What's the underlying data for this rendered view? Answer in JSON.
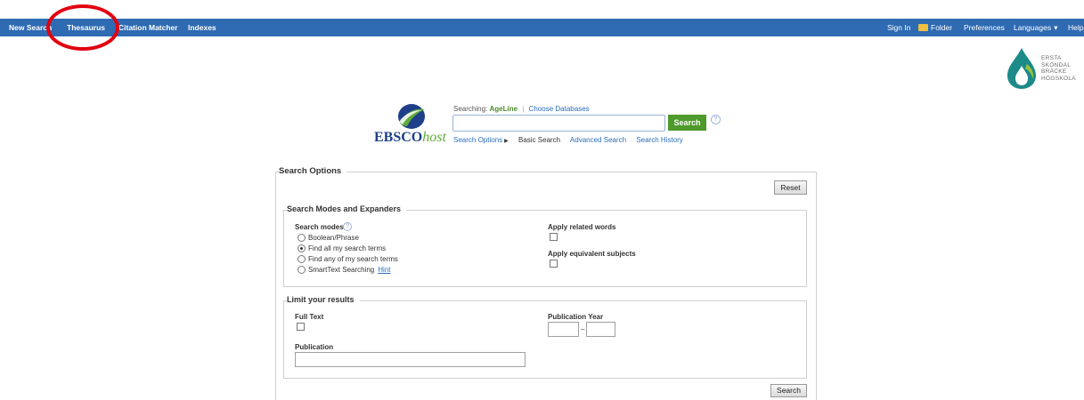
{
  "nav": {
    "new_search": "New Search",
    "thesaurus": "Thesaurus",
    "citation_matcher": "Citation Matcher",
    "indexes": "Indexes",
    "sign_in": "Sign In",
    "folder": "Folder",
    "preferences": "Preferences",
    "languages": "Languages",
    "help": "Help"
  },
  "institution": {
    "line1": "ERSTA",
    "line2": "SKÖNDAL",
    "line3": "BRÄCKE",
    "line4": "HÖGSKOLA"
  },
  "ebsco": {
    "brand": "EBSCO",
    "brand_suffix": "host",
    "searching_label": "Searching:",
    "database": "AgeLine",
    "choose_databases": "Choose Databases",
    "search_button": "Search",
    "help_mark": "?",
    "search_options": "Search Options",
    "basic_search": "Basic Search",
    "advanced_search": "Advanced Search",
    "search_history": "Search History"
  },
  "search_options": {
    "title": "Search Options",
    "reset": "Reset",
    "modes_title": "Search Modes and Expanders",
    "search_modes_label": "Search modes",
    "modes": [
      "Boolean/Phrase",
      "Find all my search terms",
      "Find any of my search terms",
      "SmartText Searching"
    ],
    "selected_mode_index": 1,
    "hint": "Hint",
    "apply_related": "Apply related words",
    "apply_equivalent": "Apply equivalent subjects",
    "limit_title": "Limit your results",
    "full_text": "Full Text",
    "publication_year": "Publication Year",
    "year_dash": "–",
    "publication": "Publication",
    "search_button": "Search"
  },
  "colors": {
    "nav_bg": "#2f6bb3",
    "search_green": "#4e9a2c",
    "annotation_red": "#e1000f"
  }
}
